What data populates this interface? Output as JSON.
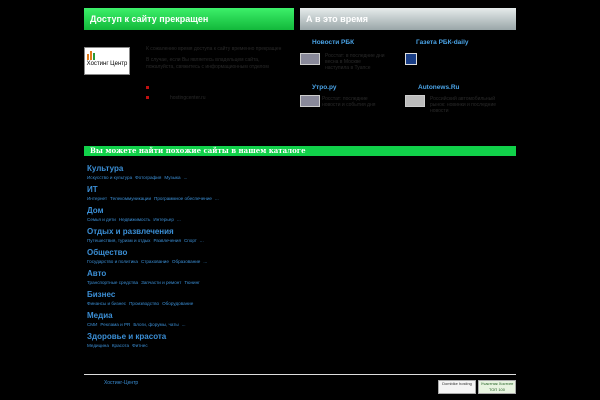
{
  "header": {
    "left_title": "Доступ к сайту прекращен",
    "right_title": "А в это время"
  },
  "notice": {
    "logo_text": "Хостинг Центр",
    "line1": "К сожалению время доступа к сайту временно прекращен",
    "line2": "В случае, если Вы являетесь владельцем сайта,",
    "line3": "пожалуйста, свяжитесь с информационным отделом",
    "link": "hostingcenter.ru"
  },
  "news": [
    {
      "title": "Новости РБК",
      "text": "Росстат: в последние дни весна в Москве наступила в Туапсе"
    },
    {
      "title": "Газета РБК-daily",
      "text": ""
    },
    {
      "title": "Утро.ру",
      "text": "Росстат: последние новости и события дня"
    },
    {
      "title": "Autonews.Ru",
      "text": "Российский автомобильный рынок: новинки и последние новости"
    }
  ],
  "catalog": {
    "heading": "Вы можете найти похожие сайты в нашем каталоге",
    "categories": [
      {
        "title": "Культура",
        "subs": [
          "Искусство и культура",
          "Фотография",
          "Музыка",
          "..."
        ]
      },
      {
        "title": "ИТ",
        "subs": [
          "Интернет",
          "Телекоммуникации",
          "Программное обеспечение",
          "..."
        ]
      },
      {
        "title": "Дом",
        "subs": [
          "Семья и дети",
          "Недвижимость",
          "Интерьер",
          "..."
        ]
      },
      {
        "title": "Отдых и развлечения",
        "subs": [
          "Путешествия, туризм и отдых",
          "Развлечения",
          "Спорт",
          "..."
        ]
      },
      {
        "title": "Общество",
        "subs": [
          "Государство и политика",
          "Страхование",
          "Образование",
          "..."
        ]
      },
      {
        "title": "Авто",
        "subs": [
          "Транспортные средства",
          "Запчасти и ремонт",
          "Тюнинг"
        ]
      },
      {
        "title": "Бизнес",
        "subs": [
          "Финансы и бизнес",
          "Производство",
          "Оборудование"
        ]
      },
      {
        "title": "Медиа",
        "subs": [
          "СМИ",
          "Реклама и PR",
          "Блоги, форумы, чаты",
          "..."
        ]
      },
      {
        "title": "Здоровье и красота",
        "subs": [
          "Медицина",
          "Красота",
          "Фитнес"
        ]
      }
    ]
  },
  "footer": {
    "text": "Хостинг-Центр",
    "badge1": "Dombike hosting",
    "badge2": "Участник Хостинг ТОП 100"
  }
}
